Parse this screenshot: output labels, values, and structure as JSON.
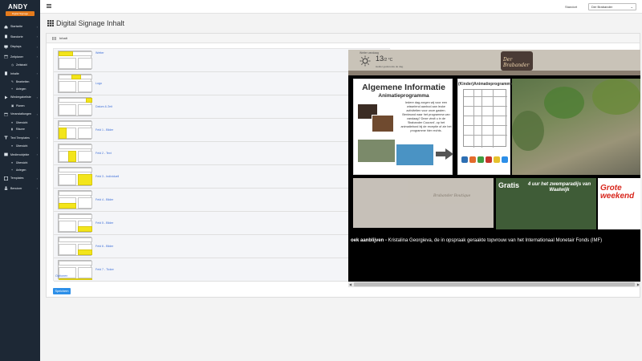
{
  "logo": {
    "text": "ANDY",
    "subtitle": "Digital Signage"
  },
  "sidebar": {
    "items": [
      {
        "label": "Startseite",
        "icon": "home-icon"
      },
      {
        "label": "Standorte",
        "icon": "building-icon"
      },
      {
        "label": "Displays",
        "icon": "monitor-icon"
      },
      {
        "label": "Zeitplaner",
        "icon": "calendar-icon"
      },
      {
        "label": "Zeitstrahl",
        "icon": "clock-icon",
        "sub": true
      },
      {
        "label": "Inhalte",
        "icon": "file-icon"
      },
      {
        "label": "Bearbeiten",
        "icon": "pencil-icon",
        "sub": true
      },
      {
        "label": "Anlegen",
        "icon": "plus-icon",
        "sub": true
      },
      {
        "label": "Wiedergabeliste",
        "icon": "play-icon"
      },
      {
        "label": "Planen",
        "icon": "calendar-icon",
        "sub": true
      },
      {
        "label": "Veranstaltungen",
        "icon": "calendar-icon"
      },
      {
        "label": "Übersicht",
        "icon": "list-icon",
        "sub": true
      },
      {
        "label": "Räume",
        "icon": "door-icon",
        "sub": true
      },
      {
        "label": "Text Templates",
        "icon": "text-icon"
      },
      {
        "label": "Übersicht",
        "icon": "list-icon",
        "sub": true
      },
      {
        "label": "Medienobjekte",
        "icon": "image-icon"
      },
      {
        "label": "Übersicht",
        "icon": "list-icon",
        "sub": true
      },
      {
        "label": "Anlegen",
        "icon": "plus-icon",
        "sub": true
      },
      {
        "label": "Templates",
        "icon": "layout-icon"
      },
      {
        "label": "Benutzer",
        "icon": "user-icon"
      }
    ]
  },
  "topbar": {
    "standort_label": "Standort",
    "standort_value": "Der Brabander"
  },
  "page": {
    "title": "Digital Signage Inhalt",
    "panel_title": "Inhalt"
  },
  "items": [
    {
      "label": "Wetter"
    },
    {
      "label": "Logo"
    },
    {
      "label": "Datum & Zeit"
    },
    {
      "label": "Feld 1 - Bilder"
    },
    {
      "label": "Feld 2 - Text"
    },
    {
      "label": "Feld 3 - Individuell"
    },
    {
      "label": "Feld 4 - Bilder"
    },
    {
      "label": "Feld 5 - Bilder"
    },
    {
      "label": "Feld 6 - Bilder"
    },
    {
      "label": "Feld 7 - Ticker"
    }
  ],
  "optionen_label": "Optionen",
  "save_label": "Speichern",
  "preview": {
    "weather_label": "Wetter vandaag",
    "temp_main": "13",
    "temp_rest": "/2 °C",
    "weather_sub": "Helder gedurende de dag.",
    "sign_text": "Der Brabander",
    "info_title": "Algemene Informatie",
    "info_subtitle": "Animatieprogramma",
    "info_text": "Iedere dag zorgen wij voor een wisselend aanbod aan leuke activiteiten voor onze gasten. Benieuwd naar het programma van vandaag? Deze vindt u in de 'Brabander Courant', op het animatiebord bij de receptie of zie het programme hier rechts.",
    "prog_title": "(Kinder)Animatieprogramma",
    "boutique_text": "Brabander Boutique",
    "promo1_title": "Gratis",
    "promo1_text": "4 uur het zwemparadijs van Waalwijk",
    "promo2_text": "Grote weekend",
    "ticker_bold": "oek aanblijven -",
    "ticker_text": " Kristalina Georgieva, de in opspraak geraakte topvrouw van het Internationaal Monetair Fonds (IMF)"
  },
  "colors": {
    "sidebar": "#1d2835",
    "accent": "#e57b1c",
    "highlight": "#f3e51b",
    "link": "#3c6ed8",
    "button": "#2d8fe8"
  }
}
